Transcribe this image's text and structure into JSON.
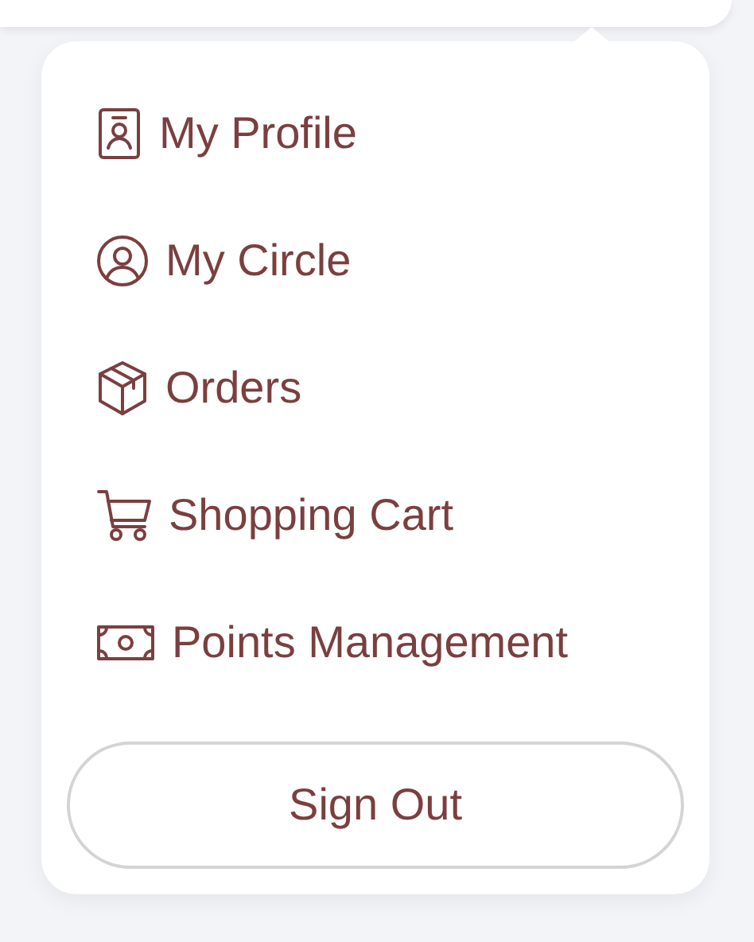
{
  "menu": {
    "items": [
      {
        "kind": "profile",
        "label": "My Profile"
      },
      {
        "kind": "circle",
        "label": "My Circle"
      },
      {
        "kind": "orders",
        "label": "Orders"
      },
      {
        "kind": "cart",
        "label": "Shopping Cart"
      },
      {
        "kind": "points",
        "label": "Points Management"
      }
    ],
    "sign_out": "Sign Out"
  }
}
